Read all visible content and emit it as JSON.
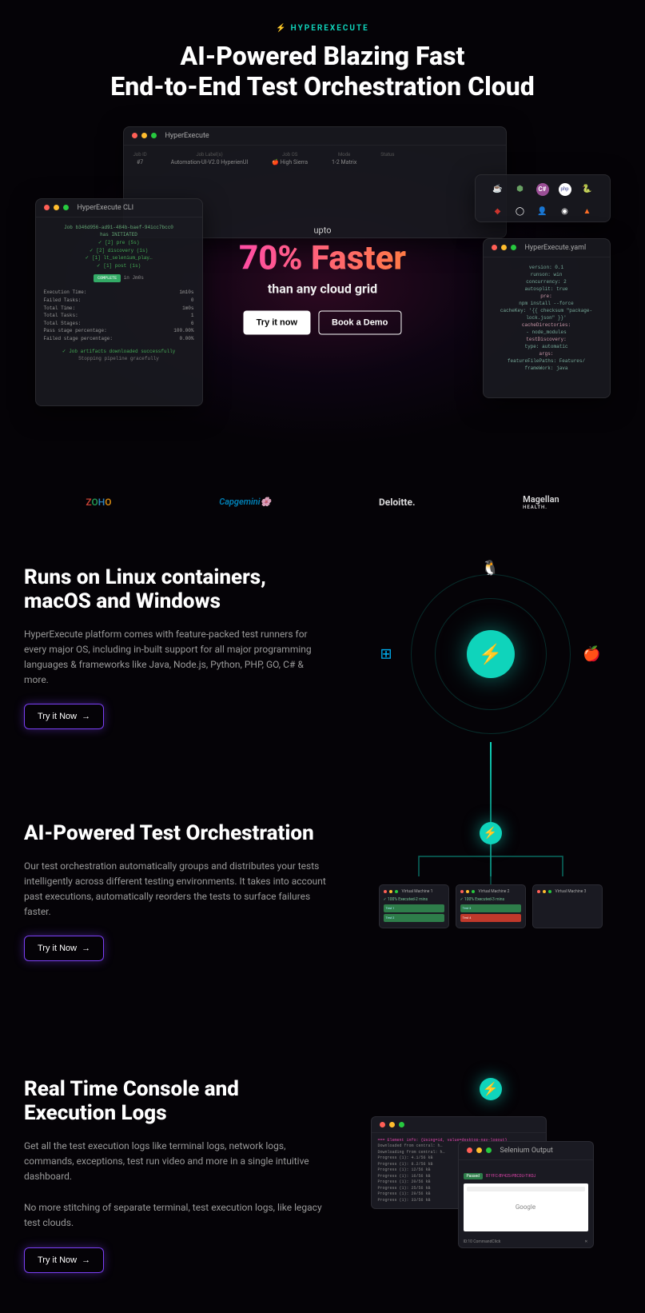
{
  "brand": "HYPEREXECUTE",
  "hero": {
    "title_l1": "AI-Powered Blazing Fast",
    "title_l2": "End-to-End Test Orchestration Cloud",
    "upto": "upto",
    "faster": "70% Faster",
    "than": "than any cloud grid",
    "try_btn": "Try it now",
    "demo_btn": "Book a Demo"
  },
  "win_main": {
    "title": "HyperExecute",
    "cols": [
      "Job ID",
      "Job Label(s)",
      "Job OS",
      "Mode",
      "Status"
    ],
    "vals": [
      "#7",
      "Automation-UI-V2.0   HyperienUI",
      "🍎 High Sierra",
      "1-2 Matrix",
      ""
    ]
  },
  "win_cli": {
    "title": "HyperExecute CLI",
    "lines": [
      "Job b346d956-ad91-484b-baef-94icc7bcc0",
      "has INITIATED",
      "✓ [2]  pre (5s)",
      "✓ [2]  discovery (1s)",
      "✓ [1]  lt_selenium_play…",
      "✓ [1]  post (1s)"
    ],
    "badge": "COMPLETE",
    "badge_suffix": "in Jm0s",
    "stats": [
      [
        "Execution Time:",
        "1m10s"
      ],
      [
        "Failed Tasks:",
        "0"
      ],
      [
        "Total Time:",
        "1m0s"
      ],
      [
        "Total Tasks:",
        "1"
      ],
      [
        "Total Stages:",
        "6"
      ],
      [
        "Pass stage percentage:",
        "100.00%"
      ],
      [
        "Failed stage percentage:",
        "0.00%"
      ]
    ],
    "footer1": "✓ Job artifacts downloaded successfully",
    "footer2": "Stopping pipeline gracefully"
  },
  "win_yaml": {
    "title": "HyperExecute.yaml",
    "lines": [
      "version: 0.1",
      "runson: win",
      "concurrency: 2",
      "autosplit: true",
      "pre:",
      "  npm install --force",
      "cacheKey: '{{ checksum \"package-lock.json\" }}'",
      "cacheDirectories:",
      "  - node_modules",
      "testDiscovery:",
      "  type: automatic",
      "  args:",
      "    featureFilePaths: Features/",
      "    frameWork: java"
    ]
  },
  "logos": {
    "zoho": "ZOHO",
    "capgemini": "Capgemini",
    "deloitte": "Deloitte.",
    "magellan": "Magellan",
    "magellan_sub": "HEALTH."
  },
  "sec1": {
    "title": "Runs on Linux containers, macOS and Windows",
    "desc": "HyperExecute platform comes with feature-packed test runners for every major OS, including in-built support for all major programming languages & frameworks like Java, Node.js, Python, PHP, GO, C# & more.",
    "btn": "Try it Now"
  },
  "sec2": {
    "title": "AI-Powered Test Orchestration",
    "desc": "Our test orchestration automatically groups and distributes your tests intelligently across different testing environments. It takes into account past executions, automatically reorders the tests to surface failures faster.",
    "btn": "Try it Now",
    "machines": [
      {
        "name": "Virtual Machine 1",
        "status": "✓ 100% Executed-2 mins",
        "tests": [
          {
            "label": "Test 1",
            "cls": "tg"
          },
          {
            "label": "Test 2",
            "cls": "tg"
          }
        ]
      },
      {
        "name": "Virtual Machine 2",
        "status": "✓ 100% Executed-3 mins",
        "tests": [
          {
            "label": "Test 3",
            "cls": "tg"
          },
          {
            "label": "Test 4",
            "cls": "tr"
          }
        ]
      },
      {
        "name": "Virtual Machine 3",
        "status": "",
        "tests": []
      }
    ]
  },
  "sec3": {
    "title": "Real Time Console and Execution Logs",
    "desc1": "Get all the test execution logs like terminal logs, network logs, commands, exceptions, test run video and more in a single intuitive dashboard.",
    "desc2": "No more stitching of separate terminal, test execution logs, like legacy test clouds.",
    "btn": "Try it Now",
    "console": {
      "hi": "=== Element info: {Using=id, value=desktop-nav-logout}",
      "lines": [
        "Downloaded from central: h…",
        "Downloading from central: h…",
        "Progress (1): 4.1/56 kB",
        "Progress (1): 8.2/56 kB",
        "Progress (1): 12/56 kB",
        "Progress (1): 16/56 kB",
        "Progress (1): 20/56 kB",
        "Progress (1): 25/56 kB",
        "Progress (1): 29/56 kB",
        "Progress (1): 33/56 kB"
      ],
      "sel_title": "Selenium Output",
      "sel_badge": "Passed",
      "sel_id": "B1YFC-BY42S-PBC0U-TIK0J",
      "sel_browser": "Google",
      "foot_l": "ID:10    CommandClick",
      "foot_r": "✕"
    }
  }
}
